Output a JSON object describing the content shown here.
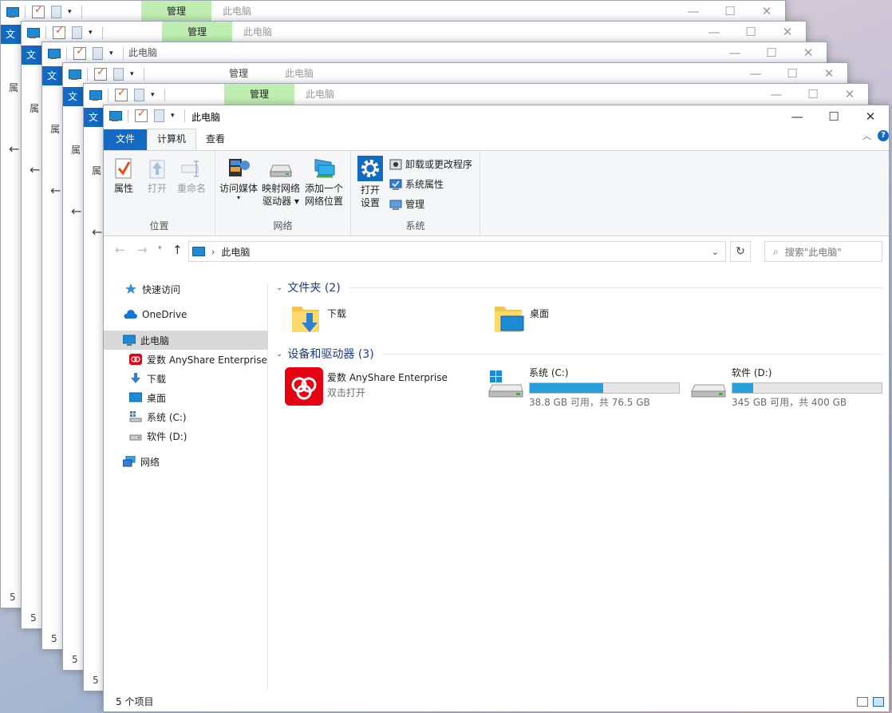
{
  "bg_windows": [
    {
      "manage_label": "管理",
      "title": "此电脑",
      "file_tab": "文",
      "prop_label": "属",
      "status_num": "5"
    },
    {
      "manage_label": "管理",
      "title": "此电脑",
      "file_tab": "文",
      "prop_label": "属",
      "status_num": "5"
    },
    {
      "manage_label": "",
      "title": "此电脑",
      "file_tab": "文",
      "prop_label": "属",
      "status_num": "5"
    },
    {
      "manage_label": "管理",
      "title": "此电脑",
      "file_tab": "文",
      "prop_label": "属",
      "status_num": "5"
    },
    {
      "manage_label": "管理",
      "title": "此电脑",
      "file_tab": "文",
      "prop_label": "属",
      "status_num": "5"
    }
  ],
  "window": {
    "title": "此电脑",
    "controls": {
      "minimize": "—",
      "maximize": "☐",
      "close": "✕"
    }
  },
  "tabs": {
    "file": "文件",
    "computer": "计算机",
    "view": "查看"
  },
  "ribbon": {
    "groups": {
      "location": "位置",
      "network": "网络",
      "system": "系统"
    },
    "properties": "属性",
    "open": "打开",
    "rename": "重命名",
    "access_media": "访问媒体",
    "map_drive": [
      "映射网络",
      "驱动器"
    ],
    "add_location": [
      "添加一个",
      "网络位置"
    ],
    "open_settings": [
      "打开",
      "设置"
    ],
    "uninstall": "卸载或更改程序",
    "system_props": "系统属性",
    "manage": "管理"
  },
  "address": {
    "path": "此电脑",
    "search_placeholder": "搜索\"此电脑\""
  },
  "nav": {
    "quick_access": "快速访问",
    "onedrive": "OneDrive",
    "this_pc": "此电脑",
    "anyshare": "爱数 AnyShare Enterprise",
    "downloads": "下载",
    "desktop": "桌面",
    "system_c": "系统 (C:)",
    "software_d": "软件 (D:)",
    "network": "网络"
  },
  "content": {
    "folders_header": "文件夹 (2)",
    "folders": [
      {
        "name": "下载"
      },
      {
        "name": "桌面"
      }
    ],
    "devices_header": "设备和驱动器 (3)",
    "anyshare": {
      "name": "爱数 AnyShare Enterprise",
      "sub": "双击打开"
    },
    "drives": [
      {
        "name": "系统 (C:)",
        "info": "38.8 GB 可用，共 76.5 GB",
        "used_fraction": 0.493
      },
      {
        "name": "软件 (D:)",
        "info": "345 GB 可用，共 400 GB",
        "used_fraction": 0.1375
      }
    ]
  },
  "status": {
    "count": "5 个项目"
  },
  "colors": {
    "accent": "#1469c3",
    "manage_tab": "#bfeeb2",
    "drive_bar": "#26a0da",
    "anyshare_red": "#e60012"
  }
}
